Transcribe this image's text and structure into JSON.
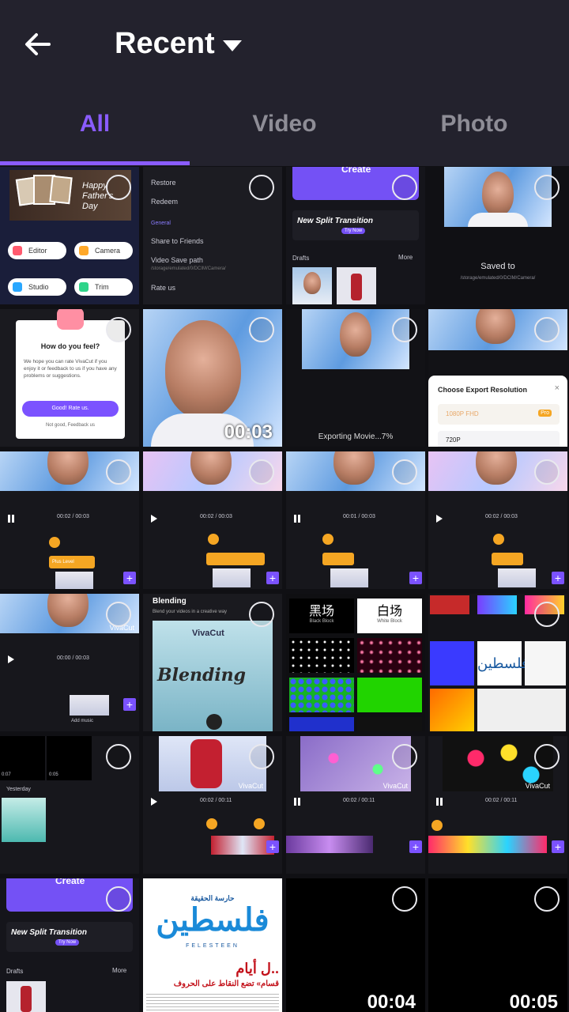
{
  "header": {
    "title": "Recent",
    "tabs": [
      {
        "label": "All",
        "active": true
      },
      {
        "label": "Video",
        "active": false
      },
      {
        "label": "Photo",
        "active": false
      }
    ]
  },
  "colors": {
    "accent": "#8a5cff",
    "header_bg": "#23222d",
    "page_bg": "#101014"
  },
  "tiles": {
    "t0": {
      "editor": "Editor",
      "camera": "Camera",
      "studio": "Studio",
      "trim": "Trim",
      "card_text": "Happy Father's Day"
    },
    "t1": {
      "restore": "Restore",
      "redeem": "Redeem",
      "general": "General",
      "share": "Share to Friends",
      "save_path": "Video Save path",
      "path_value": "/storage/emulated/0/DCIM/Camera/",
      "rate": "Rate us"
    },
    "t2": {
      "create": "Create",
      "banner": "New Split Transition",
      "try_now": "Try Now",
      "drafts": "Drafts",
      "more": "More"
    },
    "t3": {
      "saved_to": "Saved to",
      "path": "/storage/emulated/0/DCIM/Camera/"
    },
    "t4": {
      "question": "How do you feel?",
      "body": "We hope you can rate VivaCut if you enjoy it or feedback to us if you have any problems or suggestions.",
      "rate_btn": "Good! Rate us.",
      "feedback": "Not good, Feedback us"
    },
    "t5": {
      "duration": "00:03"
    },
    "t6": {
      "status": "Exporting Movie...7%"
    },
    "t7": {
      "dialog_title": "Choose Export Resolution",
      "opt1": "1080P FHD",
      "opt1_badge": "Pro",
      "opt2": "720P"
    },
    "t8": {
      "time": "00:02 / 00:03",
      "clip": "Plus Level"
    },
    "t9": {
      "time": "00:02 / 00:03"
    },
    "t10": {
      "time": "00:01 / 00:03"
    },
    "t11": {
      "time": "00:02 / 00:03"
    },
    "t12": {
      "time": "00:00 / 00:03",
      "watermark": "VivaCut",
      "music": "Add music"
    },
    "t13": {
      "title": "Blending",
      "subtitle": "Blend your videos in a creative way",
      "brand": "VivaCut",
      "art_text": "Blending"
    },
    "t14": {
      "black_block": "Black Block",
      "black_cn": "黑场",
      "white_block": "White Block",
      "white_cn": "白场"
    },
    "t15": {
      "arabic_title": "فلسطين"
    },
    "t16": {
      "label": "Yesterday",
      "dur1": "0:07",
      "dur2": "0:05"
    },
    "t17": {
      "time": "00:02 / 00:11",
      "watermark": "VivaCut"
    },
    "t18": {
      "time": "00:02 / 00:11",
      "watermark": "VivaCut"
    },
    "t19": {
      "time": "00:02 / 00:11",
      "watermark": "VivaCut"
    },
    "t20": {
      "create": "Create",
      "banner": "New Split Transition",
      "try_now": "Try Now",
      "drafts": "Drafts",
      "more": "More"
    },
    "t21": {
      "arabic_title": "فلسطين",
      "masthead": "حارسة الحقيقة",
      "latin": "FELESTEEN",
      "headline1": "ل أيام..",
      "headline2": "قسام» تضع النقاط على الحروف"
    },
    "t22": {
      "duration": "00:04"
    },
    "t23": {
      "duration": "00:05"
    }
  }
}
